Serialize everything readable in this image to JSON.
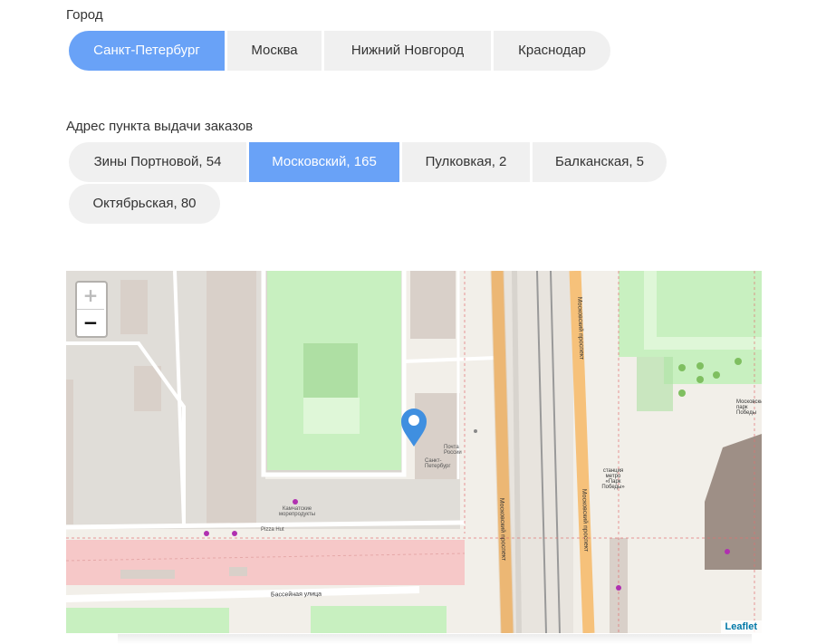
{
  "city": {
    "label": "Город",
    "options": [
      "Санкт-Петербург",
      "Москва",
      "Нижний Новгород",
      "Краснодар"
    ],
    "selected_index": 0
  },
  "address": {
    "label": "Адрес пункта выдачи заказов",
    "options": [
      "Зины Портновой, 54",
      "Московский, 165",
      "Пулковкая, 2",
      "Балканская, 5",
      "Октябрьская, 80"
    ],
    "selected_index": 1
  },
  "map": {
    "zoom_in": "+",
    "zoom_out": "−",
    "attribution": "Leaflet",
    "labels": {
      "street_bottom": "Бассейная улица",
      "street_avenue_left": "Московский проспект",
      "street_avenue_right": "Московский проспект",
      "street_avenue_top": "Московский проспект",
      "metro": "станция метро «Парк Победы»",
      "post": "Почта России",
      "bank": "Санкт-Петербург",
      "kamchatka": "Камчатские морепродукты",
      "pizza": "Pizza Hut",
      "park": "Московский парк Победы"
    },
    "colors": {
      "marker": "#3f8fe0",
      "avenue": "#f6c17a",
      "park": "#c8f0c0",
      "building": "#d9d0c9",
      "pedestrian": "#f6c8c8"
    }
  }
}
